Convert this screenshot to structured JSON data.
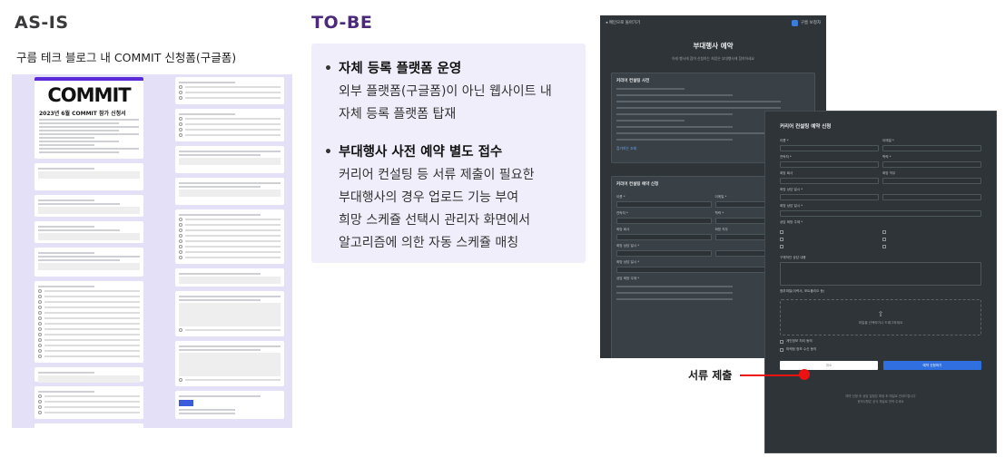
{
  "asis": {
    "title": "AS-IS",
    "subtitle": "구름 테크 블로그 내 COMMIT 신청폼(구글폼)",
    "form": {
      "logo": "COMMIT",
      "form_title": "2023년 6월 COMMIT 참가 신청서"
    }
  },
  "tobe": {
    "title": "TO-BE",
    "bullets": [
      {
        "title": "자체 등록 플랫폼 운영",
        "lines": [
          "외부 플랫폼(구글폼)이 아닌 웹사이트 내",
          "자체 등록 플랫폼 탑재"
        ]
      },
      {
        "title": "부대행사 사전 예약 별도 접수",
        "lines": [
          "커리어 컨설팅 등 서류 제출이 필요한",
          "부대행사의 경우 업로드 기능 부여",
          "희망 스케쥴 선택시 관리자 화면에서",
          "알고리즘에 의한 자동 스케쥴 매칭"
        ]
      }
    ]
  },
  "screen1": {
    "back_label": "메인으로 돌아가기",
    "user_label": "구름 보청자",
    "page_title": "부대행사 예약",
    "page_desc": "아래 행사에 참여 신청하는 희망은 부대행사에 참여하세요",
    "panel1_title": "커리어 컨설팅 사전",
    "panel1_link": "참가하는 조회",
    "panel2_title": "커리어 컨설팅 예약 신청"
  },
  "screen2": {
    "title": "커리어 컨설팅 예약 신청",
    "fields": {
      "name": "이름 *",
      "email": "이메일 *",
      "phone": "연락처 *",
      "school": "학력 *",
      "company": "희망 회사",
      "position": "희망 직무",
      "time1": "희망 상담 일시 *",
      "time2": "희망 상담 일시 *",
      "topics": "상담 희망 주제 *",
      "detail": "구체적인 상담 내용",
      "upload": "첨부파일(이력서, 포트폴리오 등)"
    },
    "upload_hint": "파일을 선택하거나 드래그하세요",
    "check1": "개인정보 처리 동의",
    "check2": "마케팅 정보 수신 동의",
    "cancel_label": "취소",
    "submit_label": "예약 신청하기",
    "footer1": "예약 신청 후 상담 일정은 확정 후 메일로 안내드립니다",
    "footer2": "문의사항은 공식 채널로 연락 주세요"
  },
  "callout": {
    "label": "서류 제출",
    "color": "#ee1111"
  },
  "colors": {
    "asis_bg": "#e3e0f8",
    "tobe_bg": "#f1eefb",
    "tobe_title": "#4b2a7a",
    "dark_bg": "#2e3438",
    "accent": "#2f6fe0"
  }
}
